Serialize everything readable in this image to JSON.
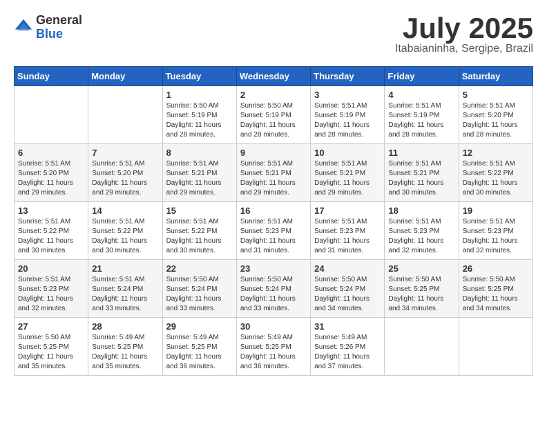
{
  "header": {
    "logo_general": "General",
    "logo_blue": "Blue",
    "month_year": "July 2025",
    "location": "Itabaianinha, Sergipe, Brazil"
  },
  "weekdays": [
    "Sunday",
    "Monday",
    "Tuesday",
    "Wednesday",
    "Thursday",
    "Friday",
    "Saturday"
  ],
  "weeks": [
    [
      null,
      null,
      {
        "day": "1",
        "sunrise": "5:50 AM",
        "sunset": "5:19 PM",
        "daylight": "11 hours and 28 minutes."
      },
      {
        "day": "2",
        "sunrise": "5:50 AM",
        "sunset": "5:19 PM",
        "daylight": "11 hours and 28 minutes."
      },
      {
        "day": "3",
        "sunrise": "5:51 AM",
        "sunset": "5:19 PM",
        "daylight": "11 hours and 28 minutes."
      },
      {
        "day": "4",
        "sunrise": "5:51 AM",
        "sunset": "5:19 PM",
        "daylight": "11 hours and 28 minutes."
      },
      {
        "day": "5",
        "sunrise": "5:51 AM",
        "sunset": "5:20 PM",
        "daylight": "11 hours and 28 minutes."
      }
    ],
    [
      {
        "day": "6",
        "sunrise": "5:51 AM",
        "sunset": "5:20 PM",
        "daylight": "11 hours and 29 minutes."
      },
      {
        "day": "7",
        "sunrise": "5:51 AM",
        "sunset": "5:20 PM",
        "daylight": "11 hours and 29 minutes."
      },
      {
        "day": "8",
        "sunrise": "5:51 AM",
        "sunset": "5:21 PM",
        "daylight": "11 hours and 29 minutes."
      },
      {
        "day": "9",
        "sunrise": "5:51 AM",
        "sunset": "5:21 PM",
        "daylight": "11 hours and 29 minutes."
      },
      {
        "day": "10",
        "sunrise": "5:51 AM",
        "sunset": "5:21 PM",
        "daylight": "11 hours and 29 minutes."
      },
      {
        "day": "11",
        "sunrise": "5:51 AM",
        "sunset": "5:21 PM",
        "daylight": "11 hours and 30 minutes."
      },
      {
        "day": "12",
        "sunrise": "5:51 AM",
        "sunset": "5:22 PM",
        "daylight": "11 hours and 30 minutes."
      }
    ],
    [
      {
        "day": "13",
        "sunrise": "5:51 AM",
        "sunset": "5:22 PM",
        "daylight": "11 hours and 30 minutes."
      },
      {
        "day": "14",
        "sunrise": "5:51 AM",
        "sunset": "5:22 PM",
        "daylight": "11 hours and 30 minutes."
      },
      {
        "day": "15",
        "sunrise": "5:51 AM",
        "sunset": "5:22 PM",
        "daylight": "11 hours and 30 minutes."
      },
      {
        "day": "16",
        "sunrise": "5:51 AM",
        "sunset": "5:23 PM",
        "daylight": "11 hours and 31 minutes."
      },
      {
        "day": "17",
        "sunrise": "5:51 AM",
        "sunset": "5:23 PM",
        "daylight": "11 hours and 31 minutes."
      },
      {
        "day": "18",
        "sunrise": "5:51 AM",
        "sunset": "5:23 PM",
        "daylight": "11 hours and 32 minutes."
      },
      {
        "day": "19",
        "sunrise": "5:51 AM",
        "sunset": "5:23 PM",
        "daylight": "11 hours and 32 minutes."
      }
    ],
    [
      {
        "day": "20",
        "sunrise": "5:51 AM",
        "sunset": "5:23 PM",
        "daylight": "11 hours and 32 minutes."
      },
      {
        "day": "21",
        "sunrise": "5:51 AM",
        "sunset": "5:24 PM",
        "daylight": "11 hours and 33 minutes."
      },
      {
        "day": "22",
        "sunrise": "5:50 AM",
        "sunset": "5:24 PM",
        "daylight": "11 hours and 33 minutes."
      },
      {
        "day": "23",
        "sunrise": "5:50 AM",
        "sunset": "5:24 PM",
        "daylight": "11 hours and 33 minutes."
      },
      {
        "day": "24",
        "sunrise": "5:50 AM",
        "sunset": "5:24 PM",
        "daylight": "11 hours and 34 minutes."
      },
      {
        "day": "25",
        "sunrise": "5:50 AM",
        "sunset": "5:25 PM",
        "daylight": "11 hours and 34 minutes."
      },
      {
        "day": "26",
        "sunrise": "5:50 AM",
        "sunset": "5:25 PM",
        "daylight": "11 hours and 34 minutes."
      }
    ],
    [
      {
        "day": "27",
        "sunrise": "5:50 AM",
        "sunset": "5:25 PM",
        "daylight": "11 hours and 35 minutes."
      },
      {
        "day": "28",
        "sunrise": "5:49 AM",
        "sunset": "5:25 PM",
        "daylight": "11 hours and 35 minutes."
      },
      {
        "day": "29",
        "sunrise": "5:49 AM",
        "sunset": "5:25 PM",
        "daylight": "11 hours and 36 minutes."
      },
      {
        "day": "30",
        "sunrise": "5:49 AM",
        "sunset": "5:25 PM",
        "daylight": "11 hours and 36 minutes."
      },
      {
        "day": "31",
        "sunrise": "5:49 AM",
        "sunset": "5:26 PM",
        "daylight": "11 hours and 37 minutes."
      },
      null,
      null
    ]
  ],
  "labels": {
    "sunrise": "Sunrise:",
    "sunset": "Sunset:",
    "daylight": "Daylight:"
  }
}
